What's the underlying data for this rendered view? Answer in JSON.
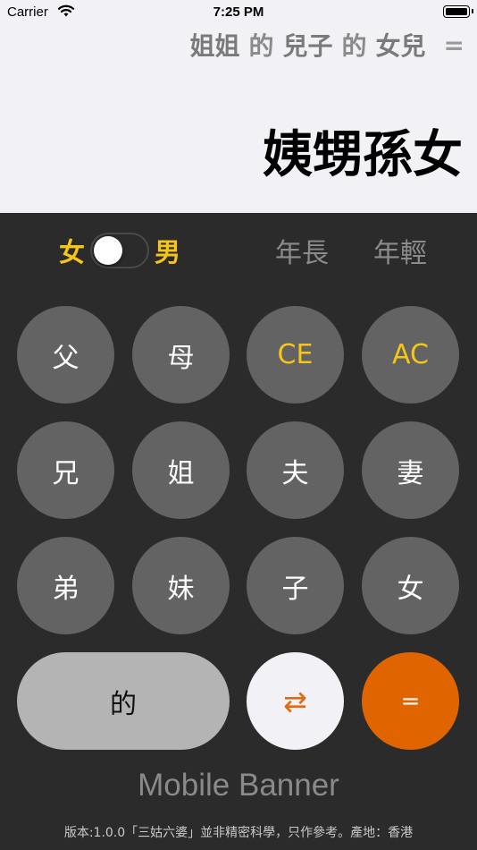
{
  "status_bar": {
    "carrier": "Carrier",
    "time": "7:25 PM"
  },
  "display": {
    "expression": [
      "姐姐",
      "的",
      "兒子",
      "的",
      "女兒"
    ],
    "equals": "=",
    "result": "姨甥孫女"
  },
  "gender": {
    "female": "女",
    "male": "男",
    "toggle_state": "female"
  },
  "age": {
    "older": "年長",
    "younger": "年輕"
  },
  "keys": {
    "father": "父",
    "mother": "母",
    "ce": "CE",
    "ac": "AC",
    "older_brother": "兄",
    "older_sister": "姐",
    "husband": "夫",
    "wife": "妻",
    "younger_brother": "弟",
    "younger_sister": "妹",
    "son": "子",
    "daughter": "女",
    "of": "的",
    "swap": "⇄",
    "equals": "="
  },
  "banner": "Mobile Banner",
  "footer": "版本:1.0.0「三姑六婆」並非精密科學，只作參考。產地：香港",
  "colors": {
    "accent_yellow": "#f5c518",
    "equals_orange": "#e06500",
    "key_gray": "#636363"
  }
}
